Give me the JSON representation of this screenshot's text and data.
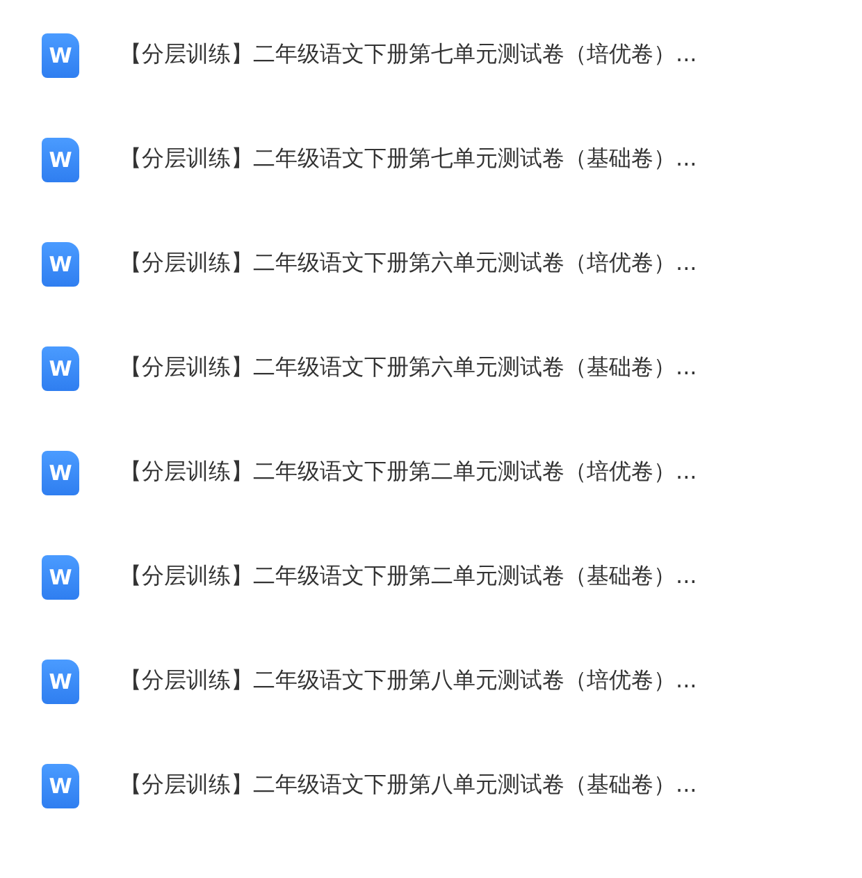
{
  "files": [
    {
      "icon": "W",
      "name": "【分层训练】二年级语文下册第七单元测试卷（培优卷）..."
    },
    {
      "icon": "W",
      "name": "【分层训练】二年级语文下册第七单元测试卷（基础卷）..."
    },
    {
      "icon": "W",
      "name": "【分层训练】二年级语文下册第六单元测试卷（培优卷）..."
    },
    {
      "icon": "W",
      "name": "【分层训练】二年级语文下册第六单元测试卷（基础卷）..."
    },
    {
      "icon": "W",
      "name": "【分层训练】二年级语文下册第二单元测试卷（培优卷）..."
    },
    {
      "icon": "W",
      "name": "【分层训练】二年级语文下册第二单元测试卷（基础卷）..."
    },
    {
      "icon": "W",
      "name": "【分层训练】二年级语文下册第八单元测试卷（培优卷）..."
    },
    {
      "icon": "W",
      "name": "【分层训练】二年级语文下册第八单元测试卷（基础卷）..."
    }
  ]
}
